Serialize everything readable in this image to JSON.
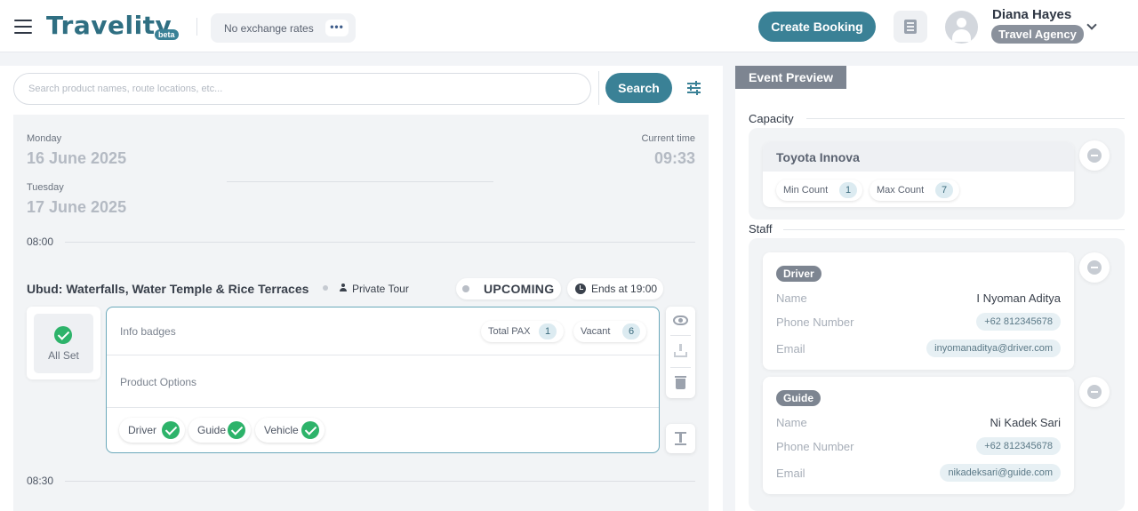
{
  "header": {
    "logo": "Travelity",
    "beta": "beta",
    "exchange_rates": "No exchange rates",
    "more": "•••",
    "create_booking": "Create Booking",
    "user_name": "Diana Hayes",
    "user_role": "Travel Agency"
  },
  "search": {
    "placeholder": "Search product names, route locations, etc...",
    "button": "Search"
  },
  "schedule": {
    "day1_name": "Monday",
    "day1_date": "16 June 2025",
    "day2_name": "Tuesday",
    "day2_date": "17 June 2025",
    "current_time_label": "Current time",
    "current_time": "09:33",
    "slot1": "08:00",
    "slot2": "08:30"
  },
  "event": {
    "title": "Ubud: Waterfalls, Water Temple & Rice Terraces",
    "type": "Private Tour",
    "status": "UPCOMING",
    "ends": "Ends at 19:00",
    "all_set": "All Set",
    "info_badges_label": "Info badges",
    "total_pax_label": "Total PAX",
    "total_pax": "1",
    "vacant_label": "Vacant",
    "vacant": "6",
    "product_options_label": "Product Options",
    "requirements": [
      "Driver",
      "Guide",
      "Vehicle"
    ]
  },
  "preview": {
    "tab": "Event Preview",
    "capacity_title": "Capacity",
    "vehicle": "Toyota Innova",
    "min_label": "Min Count",
    "min": "1",
    "max_label": "Max Count",
    "max": "7",
    "staff_title": "Staff",
    "staff": [
      {
        "role": "Driver",
        "name_label": "Name",
        "name": "I Nyoman Aditya",
        "phone_label": "Phone Number",
        "phone": "+62 812345678",
        "email_label": "Email",
        "email": "inyomanaditya@driver.com"
      },
      {
        "role": "Guide",
        "name_label": "Name",
        "name": "Ni Kadek Sari",
        "phone_label": "Phone Number",
        "phone": "+62 812345678",
        "email_label": "Email",
        "email": "nikadeksari@guide.com"
      }
    ]
  },
  "colors": {
    "accent": "#3a8196",
    "success": "#2db36a",
    "badge_gray": "#7d8591"
  },
  "icons": [
    "menu-icon",
    "more-icon",
    "list-icon",
    "avatar-icon",
    "chevron-down-icon",
    "filter-icon",
    "person-icon",
    "clock-icon",
    "check-icon",
    "eye-icon",
    "download-icon",
    "trash-icon",
    "expand-icon",
    "remove-icon"
  ]
}
